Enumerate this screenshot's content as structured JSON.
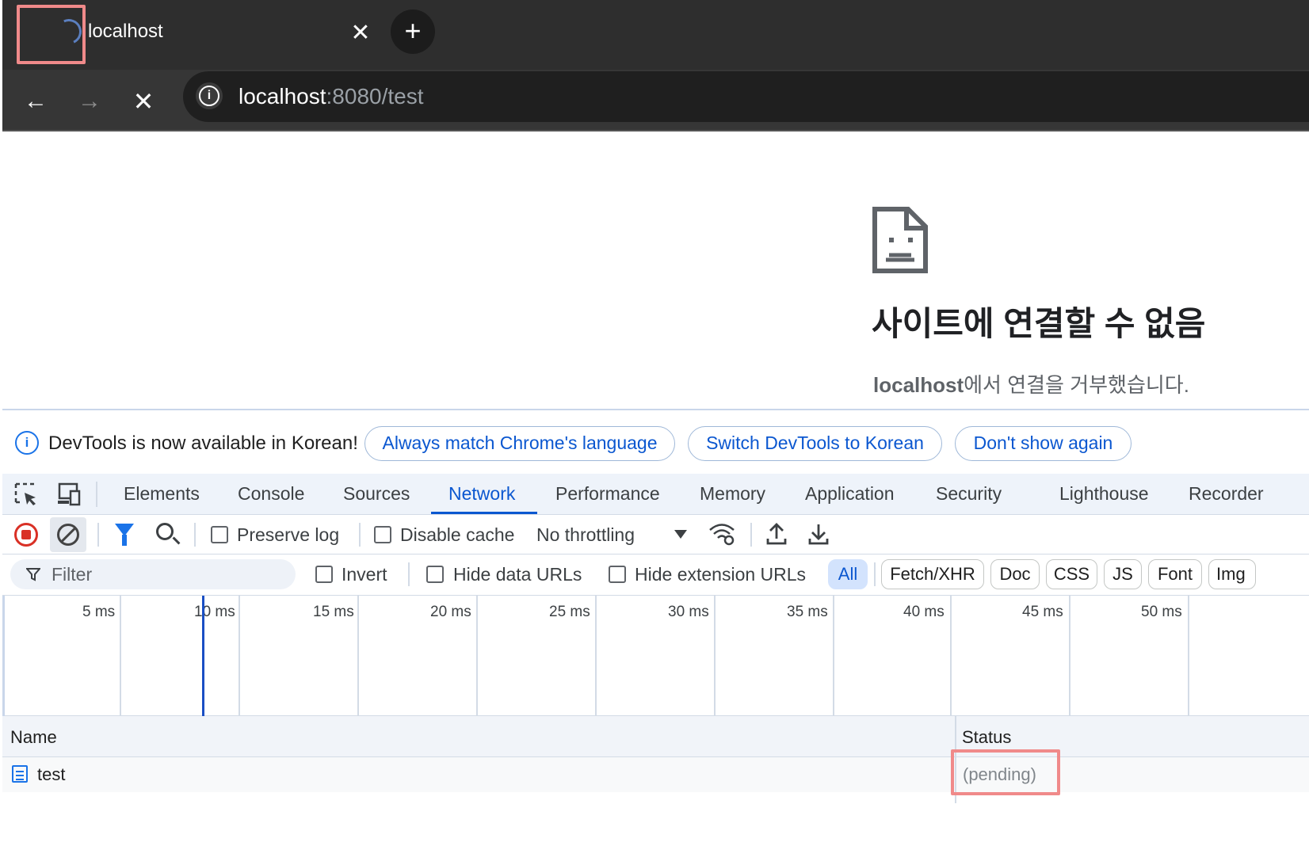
{
  "browser": {
    "tab": {
      "title": "localhost",
      "close_glyph": "✕"
    },
    "newtab_glyph": "+",
    "nav": {
      "back_glyph": "←",
      "forward_glyph": "→",
      "stop_glyph": "✕"
    },
    "omnibox": {
      "host": "localhost",
      "path": ":8080/test",
      "info_glyph": "i"
    }
  },
  "page": {
    "error_title": "사이트에 연결할 수 없음",
    "error_host": "localhost",
    "error_message": "에서 연결을 거부했습니다."
  },
  "devtools": {
    "infobar": {
      "icon_glyph": "i",
      "text": "DevTools is now available in Korean!",
      "buttons": [
        "Always match Chrome's language",
        "Switch DevTools to Korean",
        "Don't show again"
      ]
    },
    "tabs": [
      "Elements",
      "Console",
      "Sources",
      "Network",
      "Performance",
      "Memory",
      "Application",
      "Security",
      "Lighthouse",
      "Recorder"
    ],
    "active_tab": "Network",
    "network_toolbar": {
      "preserve_log": "Preserve log",
      "disable_cache": "Disable cache",
      "throttling": "No throttling"
    },
    "filter_bar": {
      "placeholder": "Filter",
      "invert": "Invert",
      "hide_data_urls": "Hide data URLs",
      "hide_extension_urls": "Hide extension URLs",
      "types": [
        "All",
        "Fetch/XHR",
        "Doc",
        "CSS",
        "JS",
        "Font",
        "Img"
      ],
      "active_type": "All"
    },
    "timeline": {
      "ticks": [
        "5 ms",
        "10 ms",
        "15 ms",
        "20 ms",
        "25 ms",
        "30 ms",
        "35 ms",
        "40 ms",
        "45 ms",
        "50 ms"
      ]
    },
    "table": {
      "columns": [
        "Name",
        "Status"
      ],
      "rows": [
        {
          "name": "test",
          "status": "(pending)"
        }
      ]
    }
  },
  "colors": {
    "accent": "#0b57d0",
    "highlight": "#f08a8a",
    "record": "#d93025"
  },
  "icons": [
    "spinner-icon",
    "close-icon",
    "plus-icon",
    "back-arrow-icon",
    "forward-arrow-icon",
    "stop-icon",
    "info-icon",
    "sad-document-icon",
    "inspect-icon",
    "device-toolbar-icon",
    "record-icon",
    "clear-icon",
    "filter-icon",
    "search-icon",
    "network-conditions-icon",
    "upload-icon",
    "download-icon",
    "document-icon"
  ]
}
